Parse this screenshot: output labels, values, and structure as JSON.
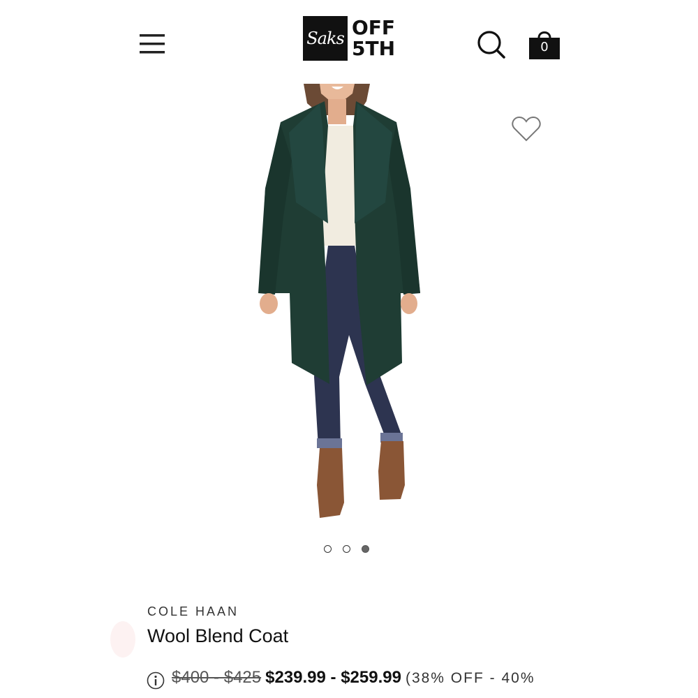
{
  "header": {
    "logo": {
      "box_text": "Saks",
      "line1": "OFF",
      "line2": "5TH"
    },
    "bag_count": "0"
  },
  "icons": {
    "menu": "hamburger-menu-icon",
    "search": "search-icon",
    "bag": "shopping-bag-icon",
    "favorite": "heart-icon",
    "info": "info-icon"
  },
  "carousel": {
    "total": 3,
    "active_index": 2
  },
  "product": {
    "brand": "COLE HAAN",
    "name": "Wool Blend Coat",
    "original_price": "$400 - $425",
    "sale_price": "$239.99 - $259.99",
    "discount": "(38% OFF - 40%"
  },
  "colors": {
    "coat": "#1f3d34",
    "sweater": "#f1ece0",
    "jeans": "#2d3450",
    "boots": "#8a5636",
    "logo_bg": "#111111"
  }
}
